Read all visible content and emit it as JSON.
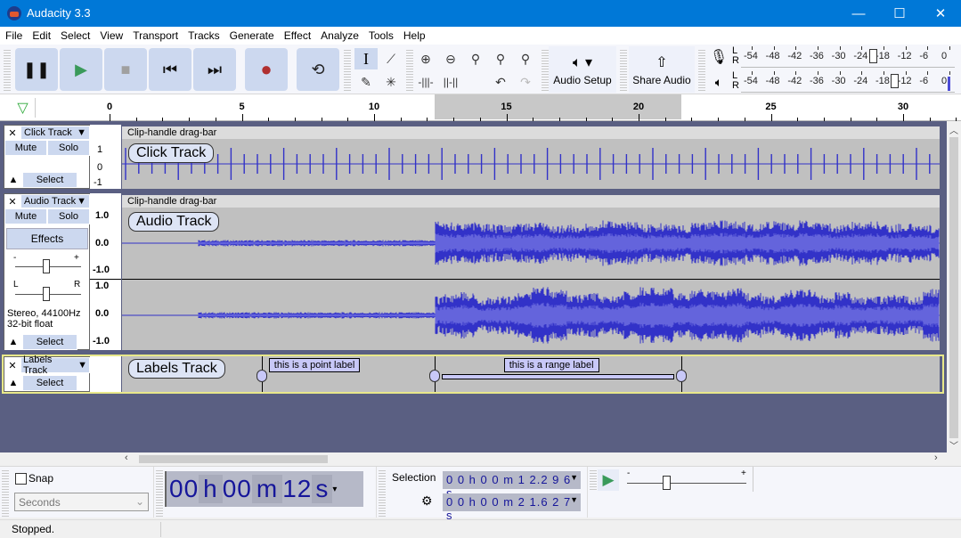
{
  "window": {
    "title": "Audacity 3.3",
    "controls": [
      "minimize-icon",
      "maximize-icon",
      "close-icon"
    ]
  },
  "menu": [
    "File",
    "Edit",
    "Select",
    "View",
    "Transport",
    "Tracks",
    "Generate",
    "Effect",
    "Analyze",
    "Tools",
    "Help"
  ],
  "transport": {
    "buttons": [
      {
        "name": "pause",
        "glyph": "❚❚",
        "color": "#111111"
      },
      {
        "name": "play",
        "glyph": "▶",
        "color": "#3a9a5a"
      },
      {
        "name": "stop",
        "glyph": "■",
        "color": "#a0a0a0"
      },
      {
        "name": "skip-to-start",
        "glyph": "⏮",
        "color": "#111111"
      },
      {
        "name": "skip-to-end",
        "glyph": "⏭",
        "color": "#111111"
      },
      {
        "name": "record",
        "glyph": "●",
        "color": "#b03030"
      },
      {
        "name": "loop",
        "glyph": "⟲",
        "color": "#222222"
      }
    ]
  },
  "tools": {
    "row1": [
      {
        "name": "selection-tool",
        "glyph": "I"
      },
      {
        "name": "envelope-tool",
        "glyph": "⟋"
      }
    ],
    "row2": [
      {
        "name": "draw-tool",
        "glyph": "✎"
      },
      {
        "name": "multi-tool",
        "glyph": "✳"
      }
    ]
  },
  "edit": {
    "row1": [
      {
        "name": "zoom-in",
        "glyph": "⊕"
      },
      {
        "name": "zoom-out",
        "glyph": "⊖"
      },
      {
        "name": "fit-selection",
        "glyph": "⚲"
      },
      {
        "name": "fit-project",
        "glyph": "⚲"
      },
      {
        "name": "zoom-toggle",
        "glyph": "⚲"
      }
    ],
    "row2": [
      {
        "name": "trim-audio",
        "glyph": "⫼"
      },
      {
        "name": "silence-audio",
        "glyph": "⫴"
      },
      {
        "name": "blank",
        "glyph": ""
      },
      {
        "name": "undo",
        "glyph": "↶"
      },
      {
        "name": "redo",
        "glyph": "↷"
      }
    ]
  },
  "audio_setup": {
    "label": "Audio Setup",
    "icon": "speaker-icon"
  },
  "share_audio": {
    "label": "Share Audio",
    "icon": "upload-icon"
  },
  "meters": {
    "scale": [
      "-54",
      "-48",
      "-42",
      "-36",
      "-30",
      "-24",
      "-18",
      "-12",
      "-6",
      "0"
    ],
    "record": {
      "channels": [
        "L",
        "R"
      ],
      "slider_db": -21
    },
    "playback": {
      "channels": [
        "L",
        "R"
      ],
      "slider_db": -15
    }
  },
  "ruler": {
    "labels": [
      {
        "v": 0
      },
      {
        "v": 5
      },
      {
        "v": 10
      },
      {
        "v": 15
      },
      {
        "v": 20
      },
      {
        "v": 25
      },
      {
        "v": 30
      }
    ],
    "selection_start_s": 12.296,
    "selection_end_s": 21.627
  },
  "tracks": {
    "click": {
      "name": "Click Track",
      "mute": "Mute",
      "solo": "Solo",
      "select": "Select",
      "scale": [
        "1",
        "0",
        "-1"
      ],
      "clip_title": "Clip-handle drag-bar",
      "label": "Click Track"
    },
    "audio": {
      "name": "Audio Track",
      "mute": "Mute",
      "solo": "Solo",
      "effects": "Effects",
      "gain_minus": "-",
      "gain_plus": "+",
      "pan_left": "L",
      "pan_right": "R",
      "info1": "Stereo, 44100Hz",
      "info2": "32-bit float",
      "select": "Select",
      "scale": [
        "1.0",
        "0.0",
        "-1.0"
      ],
      "clip_title": "Clip-handle drag-bar",
      "label": "Audio Track"
    },
    "labels": {
      "name": "Labels Track",
      "select": "Select",
      "label": "Labels Track",
      "items": [
        {
          "text": "this is a point label",
          "type": "point",
          "t": 5.75
        },
        {
          "text": "this is a range label",
          "type": "range",
          "t0": 12.296,
          "t1": 21.627
        }
      ]
    }
  },
  "bottom": {
    "snap": {
      "label": "Snap",
      "checked": false
    },
    "snap_unit": "Seconds",
    "time": {
      "hh": "00",
      "h": "h",
      "mm": "00",
      "m": "m",
      "ss": "12",
      "s": "s"
    },
    "selection_label": "Selection",
    "sel_start": "0 0 h 0 0 m 1 2.2 9 6 s",
    "sel_end": "0 0 h 0 0 m 2 1.6 2 7 s",
    "play_at_speed": {
      "minus": "-",
      "plus": "+",
      "speed": 1.0
    }
  },
  "status": "Stopped.",
  "colors": {
    "titlebar": "#0078d7",
    "wave": "#3232c8",
    "wave_rms": "#6464dc",
    "track_bg": "#5a5f82",
    "clip_bg": "#c0c0c0",
    "selection_highlight": "#ffffa0"
  }
}
